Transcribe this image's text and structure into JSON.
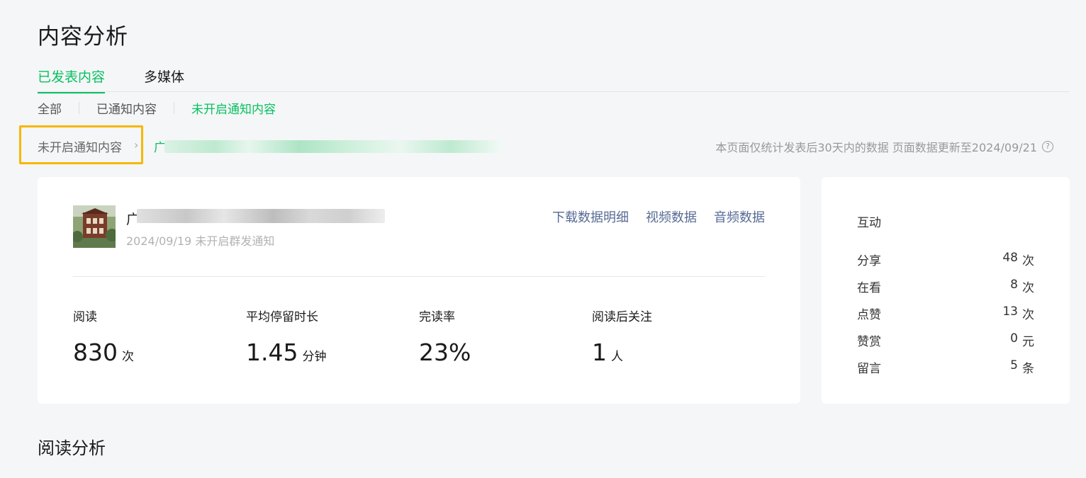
{
  "page": {
    "title": "内容分析"
  },
  "tabs": [
    {
      "label": "已发表内容"
    },
    {
      "label": "多媒体"
    }
  ],
  "subtabs": [
    {
      "label": "全部"
    },
    {
      "label": "已通知内容"
    },
    {
      "label": "未开启通知内容"
    }
  ],
  "breadcrumb": {
    "parent": "未开启通知内容",
    "current": "广"
  },
  "note": {
    "text": "本页面仅统计发表后30天内的数据 页面数据更新至2024/09/21"
  },
  "article": {
    "title": "广",
    "date": "2024/09/19",
    "status": "未开启群发通知"
  },
  "actions": [
    {
      "label": "下载数据明细"
    },
    {
      "label": "视频数据"
    },
    {
      "label": "音频数据"
    }
  ],
  "stats": [
    {
      "label": "阅读",
      "value": "830",
      "unit": "次"
    },
    {
      "label": "平均停留时长",
      "value": "1.45",
      "unit": "分钟"
    },
    {
      "label": "完读率",
      "value": "23%",
      "unit": ""
    },
    {
      "label": "阅读后关注",
      "value": "1",
      "unit": "人"
    }
  ],
  "interaction": {
    "title": "互动",
    "rows": [
      {
        "label": "分享",
        "value": "48",
        "unit": "次"
      },
      {
        "label": "在看",
        "value": "8",
        "unit": "次"
      },
      {
        "label": "点赞",
        "value": "13",
        "unit": "次"
      },
      {
        "label": "赞赏",
        "value": "0",
        "unit": "元"
      },
      {
        "label": "留言",
        "value": "5",
        "unit": "条"
      }
    ]
  },
  "section": {
    "title": "阅读分析"
  },
  "colors": {
    "accent": "#07c160",
    "link": "#576b95",
    "highlight": "#f5b800"
  }
}
